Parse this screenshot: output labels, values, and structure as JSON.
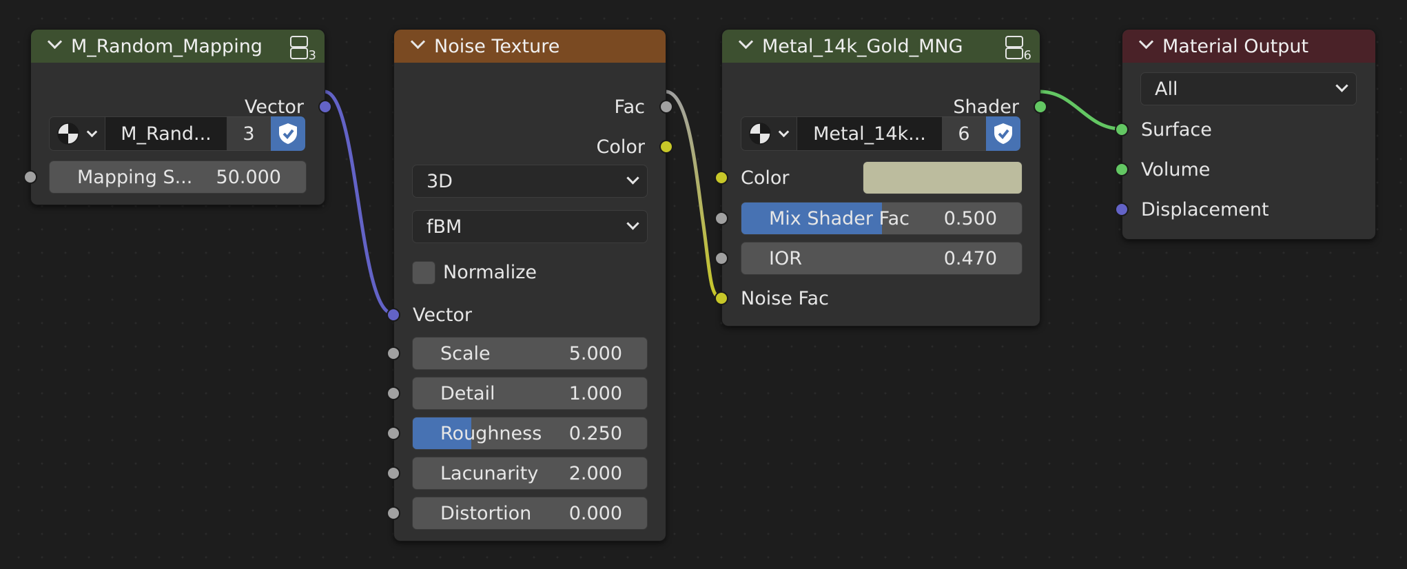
{
  "wire_colors": {
    "purple": "#6363c7",
    "grey": "#a1a1a1",
    "yellow": "#c7c729",
    "green": "#63c763"
  },
  "nodes": {
    "mapping": {
      "title": "M_Random_Mapping",
      "header_color": "#3d5030",
      "users": "3",
      "output_vector": "Vector",
      "datablock_name": "M_Rand...",
      "datablock_users": "3",
      "mapping_field": {
        "label": "Mapping S...",
        "value": "50.000"
      }
    },
    "noise": {
      "title": "Noise Texture",
      "header_color": "#7a4a22",
      "out_fac": "Fac",
      "out_color": "Color",
      "dimensions": "3D",
      "noise_type": "fBM",
      "normalize_label": "Normalize",
      "normalize_checked": false,
      "in_vector": "Vector",
      "fields": [
        {
          "label": "Scale",
          "value": "5.000",
          "fill": 0
        },
        {
          "label": "Detail",
          "value": "1.000",
          "fill": 0
        },
        {
          "label": "Roughness",
          "value": "0.250",
          "fill": 0.25
        },
        {
          "label": "Lacunarity",
          "value": "2.000",
          "fill": 0
        },
        {
          "label": "Distortion",
          "value": "0.000",
          "fill": 0
        }
      ]
    },
    "metal": {
      "title": "Metal_14k_Gold_MNG",
      "header_color": "#3d5030",
      "users": "6",
      "out_shader": "Shader",
      "datablock_name": "Metal_14k...",
      "datablock_users": "6",
      "color_label": "Color",
      "color_value": "#bcbc9e",
      "mix_field": {
        "label": "Mix Shader Fac",
        "value": "0.500",
        "fill": 0.5
      },
      "ior_field": {
        "label": "IOR",
        "value": "0.470",
        "fill": 0
      },
      "noise_fac_label": "Noise Fac"
    },
    "output": {
      "title": "Material Output",
      "header_color": "#4a2228",
      "target": "All",
      "inputs": [
        "Surface",
        "Volume",
        "Displacement"
      ]
    }
  }
}
